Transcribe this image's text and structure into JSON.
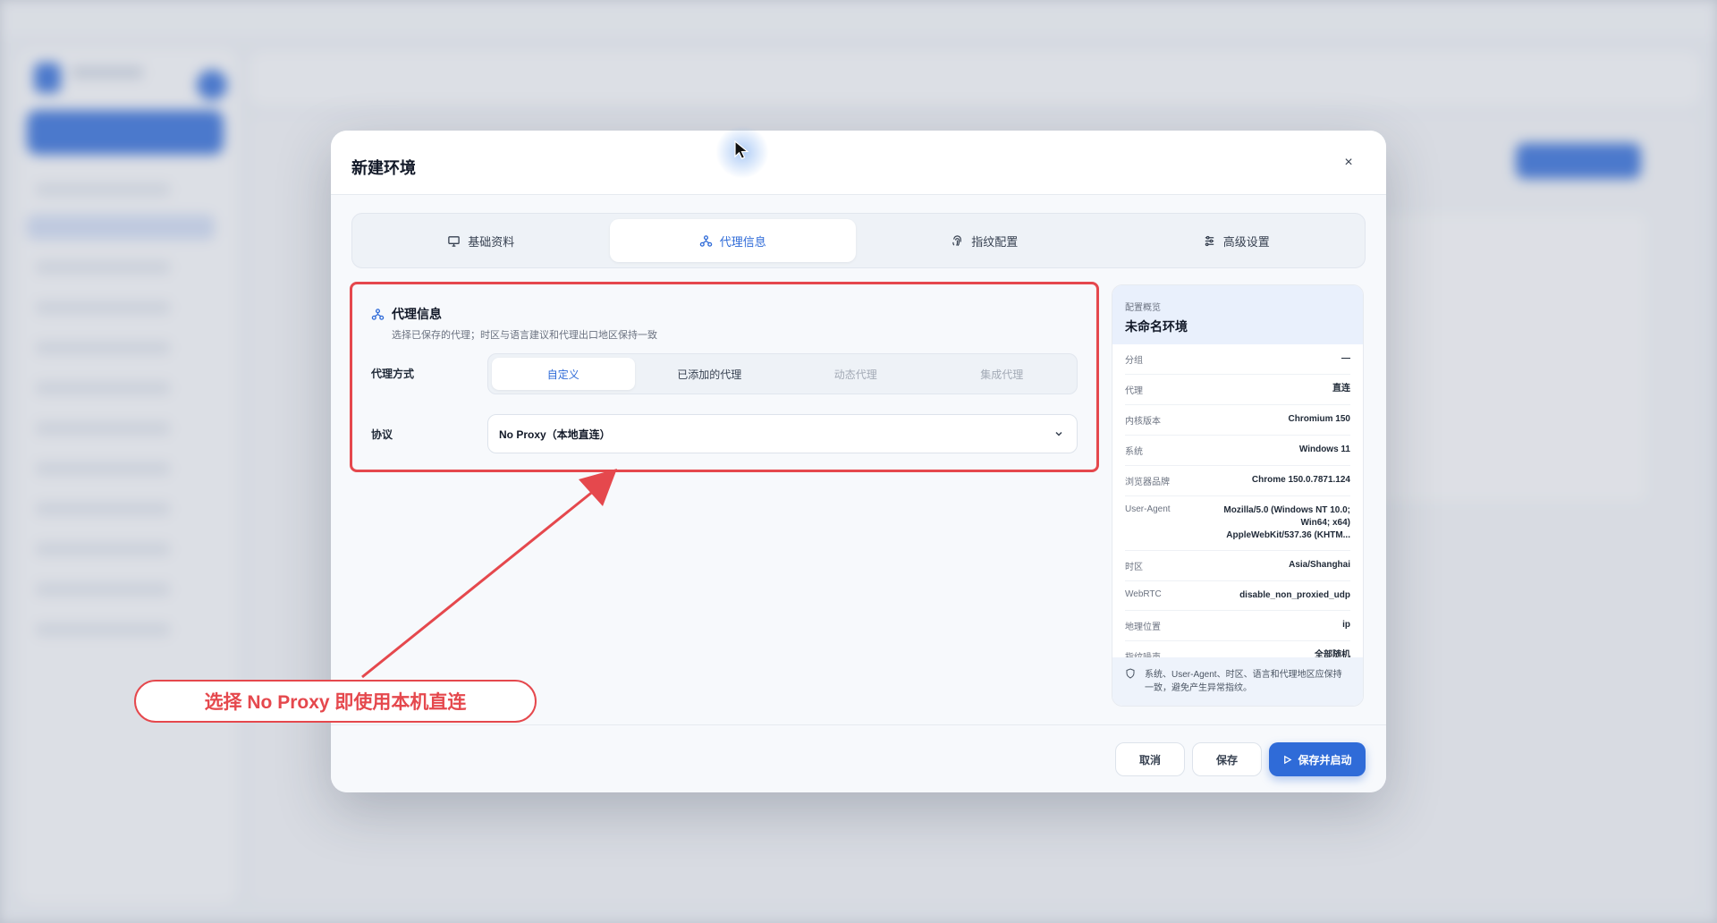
{
  "modal": {
    "title": "新建环境",
    "close": "×"
  },
  "tabs": [
    {
      "label": "基础资料",
      "icon": "monitor-icon",
      "active": false
    },
    {
      "label": "代理信息",
      "icon": "network-icon",
      "active": true
    },
    {
      "label": "指纹配置",
      "icon": "fingerprint-icon",
      "active": false
    },
    {
      "label": "高级设置",
      "icon": "sliders-icon",
      "active": false
    }
  ],
  "proxy": {
    "title": "代理信息",
    "description": "选择已保存的代理；时区与语言建议和代理出口地区保持一致",
    "mode_label": "代理方式",
    "modes": [
      {
        "label": "自定义",
        "active": true
      },
      {
        "label": "已添加的代理",
        "active": false
      },
      {
        "label": "动态代理",
        "active": false,
        "disabled": true
      },
      {
        "label": "集成代理",
        "active": false,
        "disabled": true
      }
    ],
    "protocol_label": "协议",
    "protocol_value": "No Proxy（本地直连）"
  },
  "summary": {
    "kicker": "配置概览",
    "name": "未命名环境",
    "rows": [
      {
        "key": "分组",
        "value": "—"
      },
      {
        "key": "代理",
        "value": "直连"
      },
      {
        "key": "内核版本",
        "value": "Chromium 150"
      },
      {
        "key": "系统",
        "value": "Windows 11"
      },
      {
        "key": "浏览器品牌",
        "value": "Chrome 150.0.7871.124"
      },
      {
        "key": "User-Agent",
        "value": "Mozilla/5.0 (Windows NT 10.0; Win64; x64) AppleWebKit/537.36 (KHTM..."
      },
      {
        "key": "时区",
        "value": "Asia/Shanghai"
      },
      {
        "key": "WebRTC",
        "value": "disable_non_proxied_udp"
      },
      {
        "key": "地理位置",
        "value": "ip"
      },
      {
        "key": "指纹噪声",
        "value": "全部随机"
      }
    ],
    "note": "系统、User-Agent、时区、语言和代理地区应保持一致，避免产生异常指纹。"
  },
  "footer": {
    "cancel": "取消",
    "save": "保存",
    "save_and_launch": "保存并启动"
  },
  "annotation": {
    "callout": "选择 No Proxy 即使用本机直连",
    "color": "#e5484d"
  },
  "colors": {
    "accent": "#2f6bd8",
    "annotation": "#e5484d"
  }
}
